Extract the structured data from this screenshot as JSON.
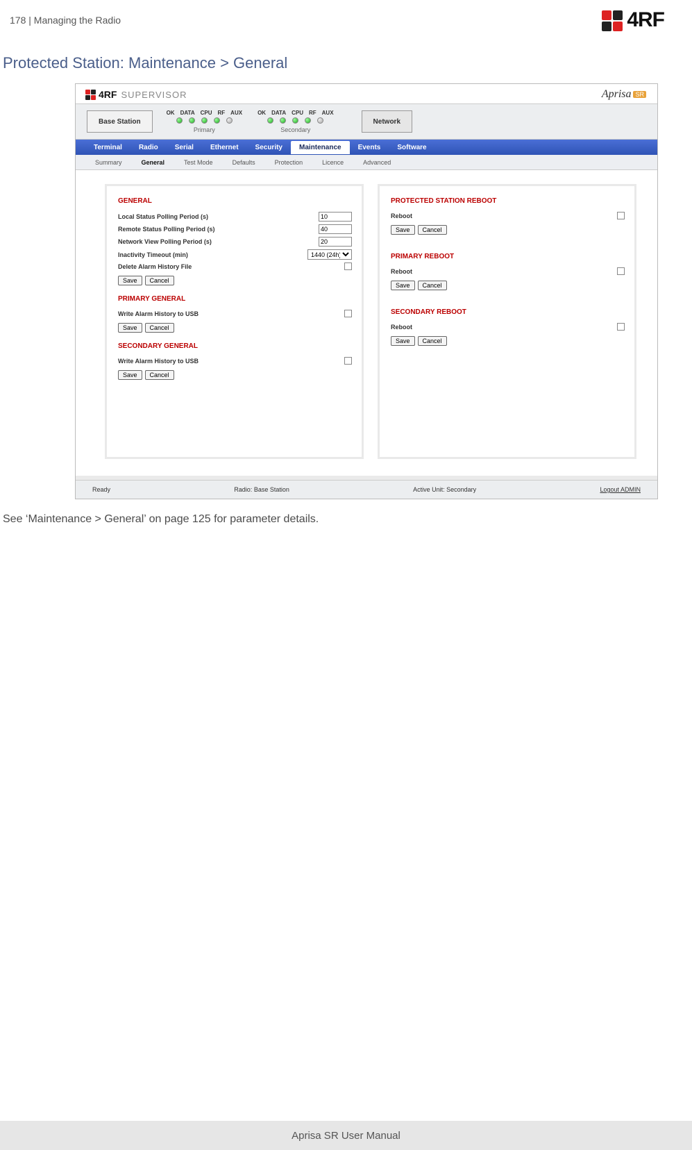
{
  "header": {
    "page_number": "178",
    "crumb": "Managing the Radio",
    "brand": "4RF"
  },
  "section_title": "Protected Station: Maintenance > General",
  "supervisor": {
    "brand_small": "4RF",
    "word": "SUPERVISOR",
    "aprisa": "Aprisa",
    "sr": "SR"
  },
  "status": {
    "station_tab": "Base Station",
    "network_tab": "Network",
    "led_labels": [
      "OK",
      "DATA",
      "CPU",
      "RF",
      "AUX"
    ],
    "primary": "Primary",
    "secondary": "Secondary"
  },
  "main_tabs": [
    "Terminal",
    "Radio",
    "Serial",
    "Ethernet",
    "Security",
    "Maintenance",
    "Events",
    "Software"
  ],
  "main_tab_active": "Maintenance",
  "sub_tabs": [
    "Summary",
    "General",
    "Test Mode",
    "Defaults",
    "Protection",
    "Licence",
    "Advanced"
  ],
  "sub_tab_active": "General",
  "left_panel": {
    "general": {
      "title": "GENERAL",
      "rows": {
        "local_status": {
          "label": "Local Status Polling Period (s)",
          "value": "10"
        },
        "remote_status": {
          "label": "Remote Status Polling Period (s)",
          "value": "40"
        },
        "netview": {
          "label": "Network View Polling Period (s)",
          "value": "20"
        },
        "inactivity": {
          "label": "Inactivity Timeout (min)",
          "value": "1440 (24h)"
        },
        "delete_alarm": {
          "label": "Delete Alarm History File"
        }
      }
    },
    "primary": {
      "title": "PRIMARY GENERAL",
      "row": {
        "label": "Write Alarm History to USB"
      }
    },
    "secondary": {
      "title": "SECONDARY GENERAL",
      "row": {
        "label": "Write Alarm History to USB"
      }
    }
  },
  "right_panel": {
    "protected": {
      "title": "PROTECTED STATION REBOOT",
      "label": "Reboot"
    },
    "primary": {
      "title": "PRIMARY REBOOT",
      "label": "Reboot"
    },
    "secondary": {
      "title": "SECONDARY REBOOT",
      "label": "Reboot"
    }
  },
  "buttons": {
    "save": "Save",
    "cancel": "Cancel"
  },
  "status_bar": {
    "ready": "Ready",
    "radio": "Radio: Base Station",
    "active": "Active Unit: Secondary",
    "logout": "Logout ADMIN"
  },
  "caption": "See ‘Maintenance > General’ on page 125 for parameter details.",
  "footer": "Aprisa SR User Manual"
}
